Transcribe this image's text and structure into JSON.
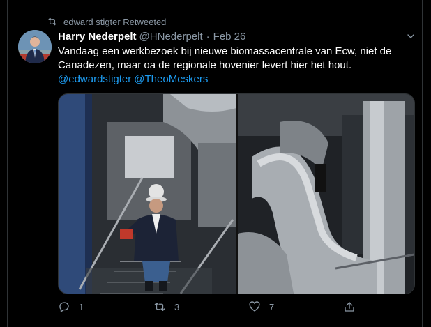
{
  "retweet": {
    "label": "edward stigter Retweeted",
    "icon": "retweet-icon"
  },
  "tweet": {
    "display_name": "Harry Nederpelt",
    "handle": "@HNederpelt",
    "separator": "·",
    "date": "Feb 26",
    "text": "Vandaag een werkbezoek bij nieuwe biomassacentrale van Ecw, niet de Canadezen, maar oa de regionale hovenier levert hier het hout.",
    "mentions": [
      "@edwardstigter",
      "@TheoMeskers"
    ],
    "menu_icon": "chevron-down-icon"
  },
  "actions": {
    "reply": {
      "icon": "reply-icon",
      "count": "1"
    },
    "retweet": {
      "icon": "retweet-icon",
      "count": "3"
    },
    "like": {
      "icon": "heart-icon",
      "count": "7"
    },
    "share": {
      "icon": "share-icon",
      "count": ""
    }
  },
  "colors": {
    "background": "#000000",
    "link": "#1d9bf0",
    "muted": "#8b98a5",
    "border": "#2f3336"
  }
}
